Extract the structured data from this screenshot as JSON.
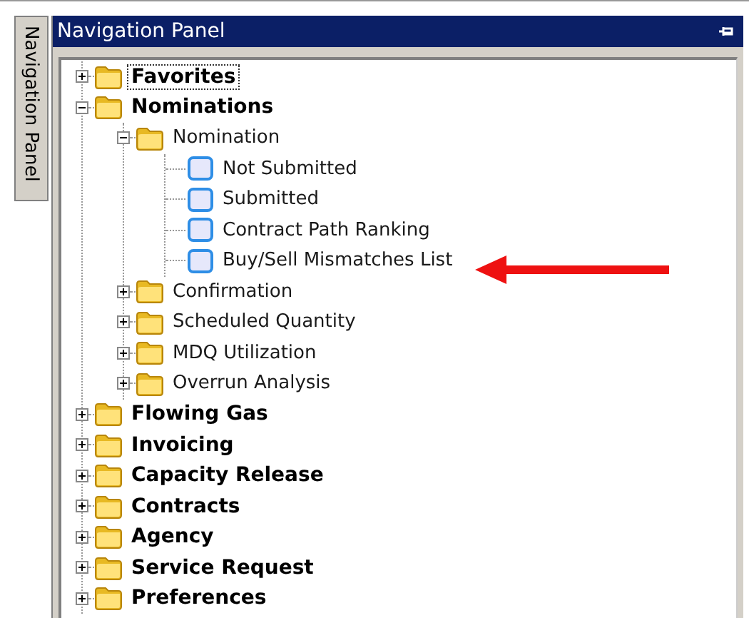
{
  "side_tab": {
    "label": "Navigation Panel"
  },
  "panel": {
    "title": "Navigation Panel"
  },
  "tree": [
    {
      "label": "Favorites",
      "kind": "folder",
      "expanded": false,
      "selected": true
    },
    {
      "label": "Nominations",
      "kind": "folder",
      "expanded": true,
      "selected": false,
      "children": [
        {
          "label": "Nomination",
          "kind": "folder",
          "expanded": true,
          "selected": false,
          "children": [
            {
              "label": "Not Submitted",
              "kind": "page",
              "selected": false
            },
            {
              "label": "Submitted",
              "kind": "page",
              "selected": false
            },
            {
              "label": "Contract Path Ranking",
              "kind": "page",
              "selected": false
            },
            {
              "label": "Buy/Sell Mismatches List",
              "kind": "page",
              "selected": false
            }
          ]
        },
        {
          "label": "Confirmation",
          "kind": "folder",
          "expanded": false,
          "selected": false
        },
        {
          "label": "Scheduled Quantity",
          "kind": "folder",
          "expanded": false,
          "selected": false
        },
        {
          "label": "MDQ Utilization",
          "kind": "folder",
          "expanded": false,
          "selected": false
        },
        {
          "label": "Overrun Analysis",
          "kind": "folder",
          "expanded": false,
          "selected": false
        }
      ]
    },
    {
      "label": "Flowing Gas",
      "kind": "folder",
      "expanded": false,
      "selected": false
    },
    {
      "label": "Invoicing",
      "kind": "folder",
      "expanded": false,
      "selected": false
    },
    {
      "label": "Capacity Release",
      "kind": "folder",
      "expanded": false,
      "selected": false
    },
    {
      "label": "Contracts",
      "kind": "folder",
      "expanded": false,
      "selected": false
    },
    {
      "label": "Agency",
      "kind": "folder",
      "expanded": false,
      "selected": false
    },
    {
      "label": "Service Request",
      "kind": "folder",
      "expanded": false,
      "selected": false
    },
    {
      "label": "Preferences",
      "kind": "folder",
      "expanded": false,
      "selected": false
    }
  ]
}
